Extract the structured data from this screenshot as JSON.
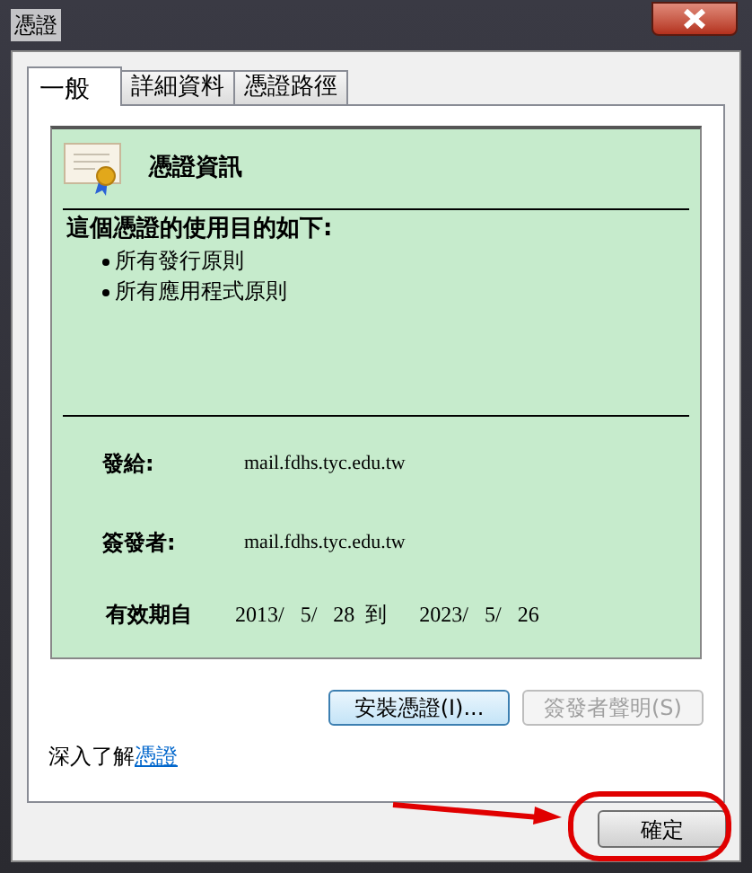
{
  "window": {
    "title": "憑證"
  },
  "tabs": [
    {
      "label": "一般",
      "selected": true
    },
    {
      "label": "詳細資料",
      "selected": false
    },
    {
      "label": "憑證路徑",
      "selected": false
    }
  ],
  "info": {
    "heading": "憑證資訊",
    "purpose_title": "這個憑證的使用目的如下:",
    "purposes": [
      "所有發行原則",
      "所有應用程式原則"
    ],
    "fields": [
      {
        "label": "發給:",
        "value": "mail.fdhs.tyc.edu.tw"
      },
      {
        "label": "簽發者:",
        "value": "mail.fdhs.tyc.edu.tw"
      }
    ],
    "validity": {
      "label": "有效期自",
      "from": "2013/   5/   28",
      "to_word": "到",
      "to": "2023/   5/   26"
    }
  },
  "buttons": [
    {
      "label": "安裝憑證(I)...",
      "disabled": false
    },
    {
      "label": "簽發者聲明(S)",
      "disabled": true
    }
  ],
  "learn_more": {
    "text": "深入了解",
    "link": "憑證"
  },
  "ok_button": {
    "label": "確定"
  }
}
